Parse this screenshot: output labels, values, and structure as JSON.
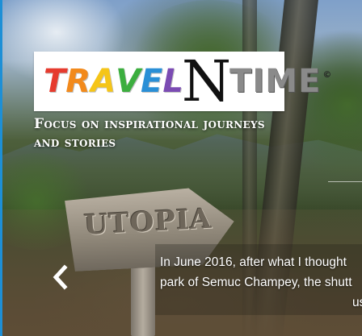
{
  "logo": {
    "letters": [
      {
        "char": "T",
        "color": "#e63b2e"
      },
      {
        "char": "R",
        "color": "#f28a1c"
      },
      {
        "char": "A",
        "color": "#f5c518"
      },
      {
        "char": "V",
        "color": "#3cae3f"
      },
      {
        "char": "E",
        "color": "#2a8fd6"
      },
      {
        "char": "L",
        "color": "#7b4bb3"
      }
    ],
    "n_letter": "N",
    "time_text": "TIME",
    "registered_mark": "©"
  },
  "tagline": {
    "line1": "Focus on inspirational journeys",
    "line2": "and stories"
  },
  "sign": {
    "text": "UTOPIA"
  },
  "slide": {
    "caption_line1": "In June 2016, after what I thought",
    "caption_line2": "park of Semuc Champey, the shutt",
    "caption_line3": "us"
  },
  "controls": {
    "prev_icon": "chevron-left-icon"
  },
  "colors": {
    "accent_edge": "#1d8fd6",
    "caption_text": "#ffffff"
  }
}
